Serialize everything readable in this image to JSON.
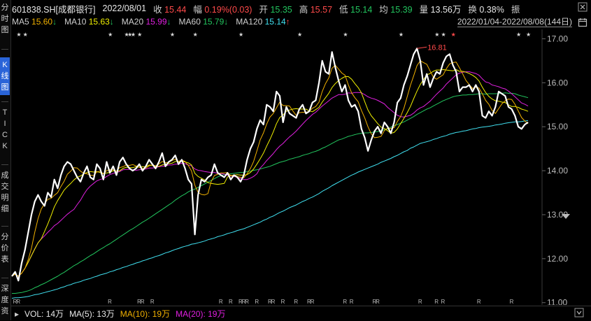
{
  "sidebar": {
    "tabs": [
      {
        "label": "分时图",
        "chars": [
          "分",
          "时",
          "图"
        ],
        "active": false
      },
      {
        "label": "K线图",
        "chars": [
          "K",
          "线",
          "图"
        ],
        "active": true
      },
      {
        "label": "TICK",
        "chars": [
          "T",
          "I",
          "C",
          "K"
        ],
        "active": false
      },
      {
        "label": "成交明细",
        "chars": [
          "成",
          "交",
          "明",
          "细"
        ],
        "active": false
      },
      {
        "label": "分价表",
        "chars": [
          "分",
          "价",
          "表"
        ],
        "active": false
      },
      {
        "label": "深度资",
        "chars": [
          "深",
          "度",
          "资"
        ],
        "active": false
      }
    ]
  },
  "header": {
    "symbol": "601838.SH[成都银行]",
    "date": "2022/08/01",
    "close_label": "收",
    "close": "15.44",
    "change_label": "幅",
    "change": "0.19%(0.03)",
    "open_label": "开",
    "open": "15.35",
    "high_label": "高",
    "high": "15.57",
    "low_label": "低",
    "low": "15.14",
    "avg_label": "均",
    "avg": "15.39",
    "volume_label": "量",
    "volume": "13.56万",
    "turnover_label": "换",
    "turnover": "0.38%",
    "amp_label": "振"
  },
  "ma_legend": [
    {
      "name": "MA5",
      "value": "15.60",
      "arrow": "↓",
      "color": "#f0b000"
    },
    {
      "name": "MA10",
      "value": "15.63",
      "arrow": "↓",
      "color": "#f0f000"
    },
    {
      "name": "MA20",
      "value": "15.99",
      "arrow": "↓",
      "color": "#e020e0"
    },
    {
      "name": "MA60",
      "value": "15.79",
      "arrow": "↓",
      "color": "#22c55e"
    },
    {
      "name": "MA120",
      "value": "15.14",
      "arrow": "↑",
      "color": "#40e0f0"
    }
  ],
  "date_range": "2022/01/04-2022/08/08(144日)",
  "icons": {
    "close": "close-icon",
    "calendar": "calendar-icon",
    "dropdown": "chevron-down-icon",
    "expand": "chevron-down-icon"
  },
  "chart_data": {
    "type": "line",
    "y_ticks": [
      "17.00",
      "16.00",
      "15.00",
      "14.00",
      "13.00",
      "12.00",
      "11.00"
    ],
    "ylim": [
      10.98,
      17.15
    ],
    "peak_annotation": "16.81",
    "series": [
      {
        "name": "收盘",
        "color": "#ffffff",
        "values": [
          11.6,
          11.7,
          11.5,
          11.9,
          12.2,
          12.6,
          13.0,
          13.3,
          13.45,
          13.3,
          13.2,
          13.5,
          13.4,
          13.8,
          13.6,
          13.9,
          14.1,
          14.2,
          14.15,
          14.0,
          13.85,
          13.75,
          13.95,
          14.1,
          13.85,
          13.8,
          14.15,
          14.05,
          13.8,
          14.2,
          13.95,
          14.1,
          13.9,
          14.2,
          14.3,
          14.15,
          14.05,
          14.0,
          14.05,
          14.15,
          14.0,
          14.1,
          14.25,
          14.15,
          14.05,
          14.2,
          14.4,
          14.1,
          14.2,
          14.25,
          14.35,
          14.15,
          14.25,
          14.05,
          13.8,
          13.7,
          12.55,
          13.45,
          13.8,
          13.75,
          13.85,
          13.9,
          14.15,
          13.95,
          13.9,
          13.85,
          13.95,
          13.8,
          13.9,
          13.85,
          13.75,
          13.9,
          14.25,
          14.5,
          14.65,
          14.95,
          15.15,
          15.05,
          15.5,
          15.45,
          15.35,
          15.8,
          15.7,
          15.1,
          15.45,
          15.3,
          15.25,
          15.2,
          15.4,
          15.5,
          15.3,
          15.35,
          15.55,
          15.6,
          16.0,
          16.5,
          16.25,
          16.2,
          16.7,
          16.35,
          16.05,
          15.8,
          15.95,
          15.6,
          15.45,
          15.5,
          15.35,
          14.95,
          14.75,
          14.45,
          14.7,
          14.9,
          15.0,
          14.85,
          15.1,
          15.0,
          14.85,
          15.1,
          15.55,
          15.65,
          15.95,
          16.15,
          16.4,
          16.65,
          16.78,
          16.5,
          15.95,
          16.2,
          15.9,
          16.1,
          16.25,
          16.2,
          16.45,
          16.6,
          16.65,
          16.4,
          16.25,
          15.8,
          15.9,
          15.9,
          15.95,
          15.8,
          15.95,
          15.8,
          15.25,
          15.2,
          15.35,
          15.25,
          15.45,
          15.8,
          15.75,
          15.7,
          15.45,
          15.4,
          15.25,
          15.0,
          14.95,
          15.05,
          15.1
        ]
      },
      {
        "name": "MA5",
        "color": "#f0b000",
        "values": []
      },
      {
        "name": "MA10",
        "color": "#f0f000",
        "values": []
      },
      {
        "name": "MA20",
        "color": "#e020e0",
        "values": []
      },
      {
        "name": "MA60",
        "color": "#22c55e",
        "values": []
      },
      {
        "name": "MA120",
        "color": "#40e0f0",
        "values": []
      }
    ],
    "star_markers": "★",
    "bottom_markers": "R",
    "grid": false
  },
  "volume_legend": [
    {
      "label": "VOL: 14万",
      "color": "#e8e8e8"
    },
    {
      "label": "MA(5): 13万",
      "color": "#e8e8e8"
    },
    {
      "label": "MA(10): 19万",
      "color": "#f0b000"
    },
    {
      "label": "MA(20): 19万",
      "color": "#e020e0"
    }
  ]
}
